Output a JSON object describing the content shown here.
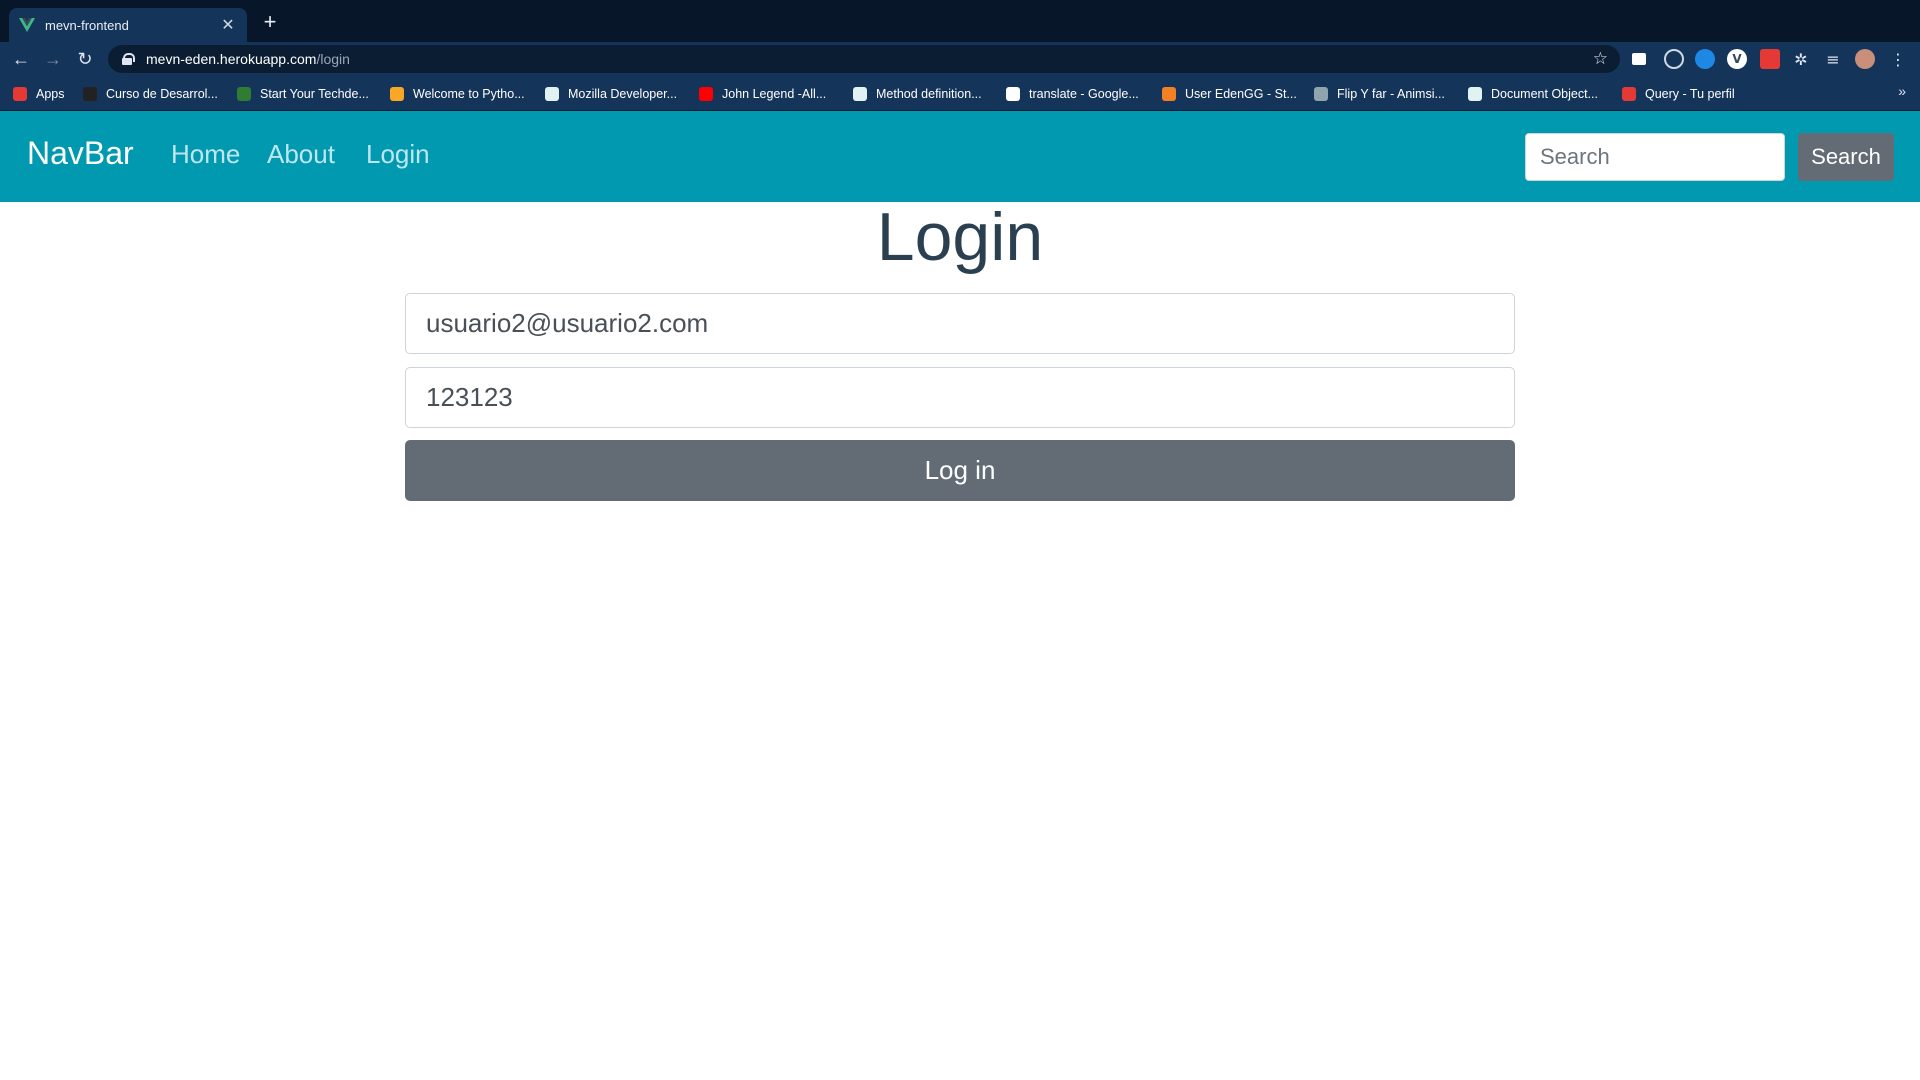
{
  "browser": {
    "tab_title": "mevn-frontend",
    "url_host": "mevn-eden.herokuapp.com",
    "url_path": "/login",
    "bookmarks": [
      {
        "label": "Apps",
        "color": "#e53935"
      },
      {
        "label": "Curso de Desarrol...",
        "color": "#222222"
      },
      {
        "label": "Start Your Techde...",
        "color": "#2e7d32"
      },
      {
        "label": "Welcome to Pytho...",
        "color": "#f9a825"
      },
      {
        "label": "Mozilla Developer...",
        "color": "#e0f2f1"
      },
      {
        "label": "John Legend -All...",
        "color": "#ff0000"
      },
      {
        "label": "Method definition...",
        "color": "#e0f2f1"
      },
      {
        "label": "translate - Google...",
        "color": "#ffffff"
      },
      {
        "label": "User EdenGG - St...",
        "color": "#f48024"
      },
      {
        "label": "Flip Y far - Animsi...",
        "color": "#90a4ae"
      },
      {
        "label": "Document Object...",
        "color": "#e0f2f1"
      },
      {
        "label": "Query - Tu perfil",
        "color": "#e53935"
      }
    ]
  },
  "navbar": {
    "brand": "NavBar",
    "links": [
      "Home",
      "About",
      "Login"
    ],
    "search_placeholder": "Search",
    "search_button": "Search",
    "background": "#0099b0"
  },
  "main": {
    "title": "Login",
    "email_value": "usuario2@usuario2.com",
    "password_value": "123123",
    "submit_label": "Log in"
  }
}
